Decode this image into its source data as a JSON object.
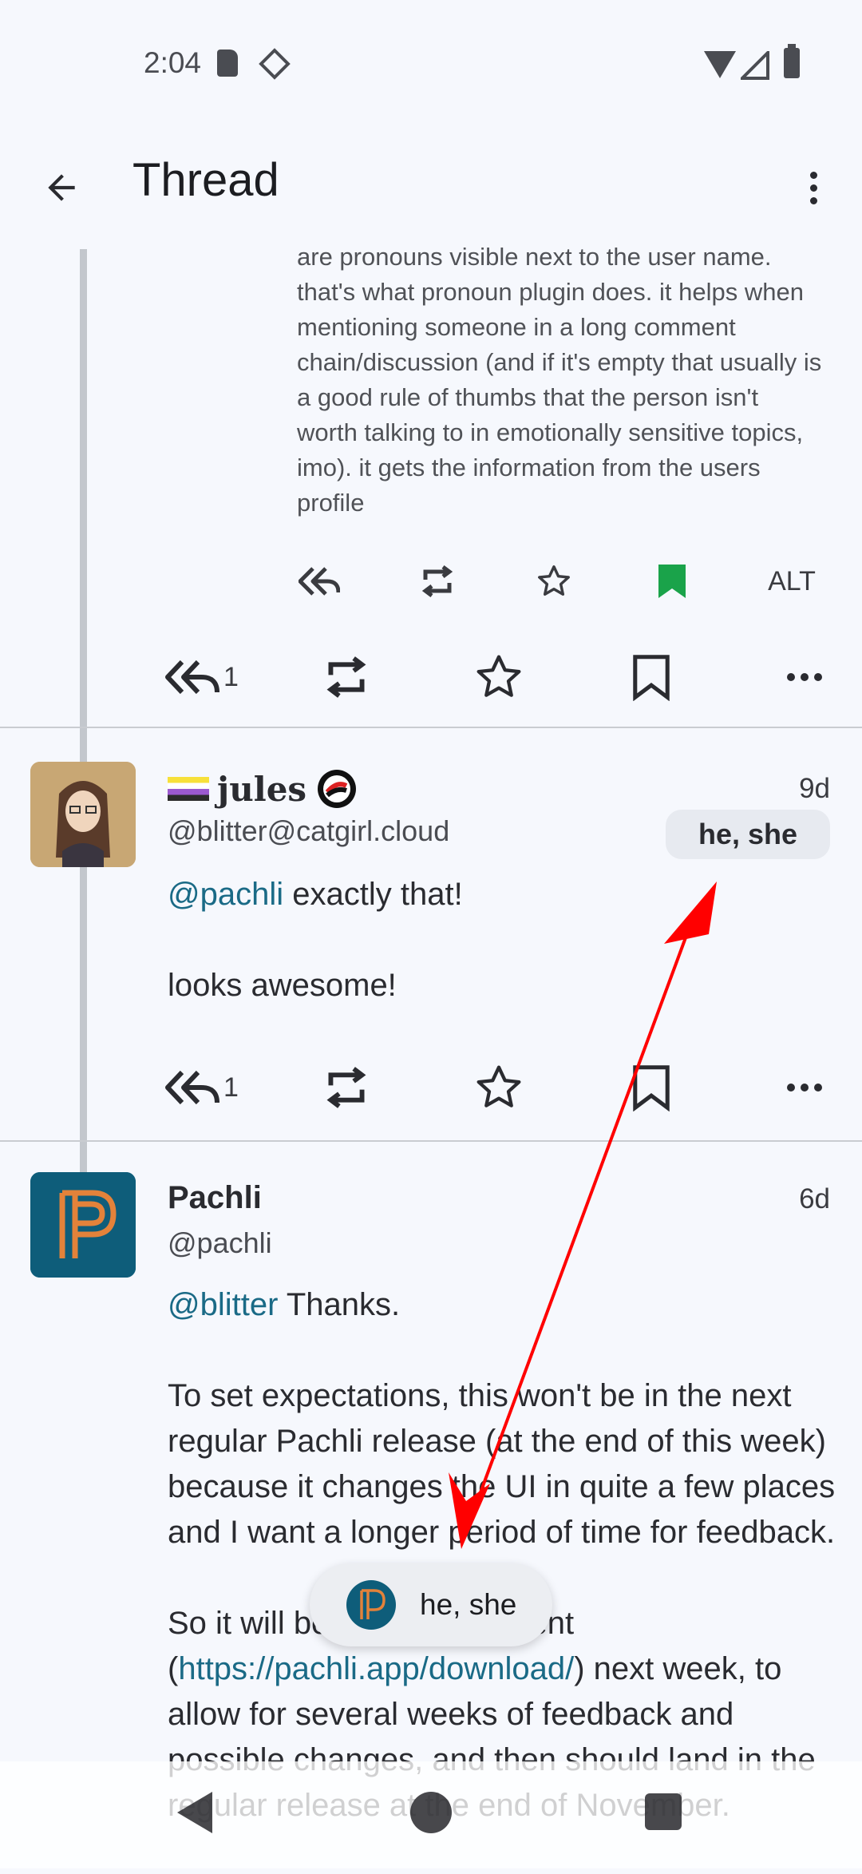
{
  "status_bar": {
    "time": "2:04"
  },
  "app_bar": {
    "title": "Thread"
  },
  "previous_post": {
    "image_text": "are pronouns visible next to the user name. that's what pronoun plugin does. it helps when mentioning someone in a long comment chain/discussion (and if it's empty that usually is a good rule of thumbs that the person isn't worth talking to in emotionally sensitive topics, imo). it gets the information from the users profile",
    "image_alt_label": "ALT",
    "reply_count": "1"
  },
  "post_jules": {
    "display_name": "jules",
    "handle": "@blitter@catgirl.cloud",
    "date": "9d",
    "pronouns": "he, she",
    "mention": "@pachli",
    "text_1": " exactly that!",
    "text_2": "looks awesome!",
    "reply_count": "1"
  },
  "post_pachli": {
    "display_name": "Pachli",
    "handle": "@pachli",
    "date": "6d",
    "mention": "@blitter",
    "text_1": " Thanks.",
    "paragraph_2": "To set expectations, this won't be in the next regular Pachli release (at the end of this week) because it changes the UI in quite a few places and I want a longer period of time for feedback.",
    "paragraph_3_start": "So it will be in Pachli Current (",
    "link": "https://pachli.app/download/",
    "paragraph_3_end": ") next week, to allow for several weeks of feedback and possible changes, and then should land in the regular release at the end of November."
  },
  "toast": {
    "text": "he, she"
  },
  "colors": {
    "accent": "#1a6a86",
    "bookmark_active": "#1aa34a",
    "annotation_arrow": "#ff0000"
  }
}
